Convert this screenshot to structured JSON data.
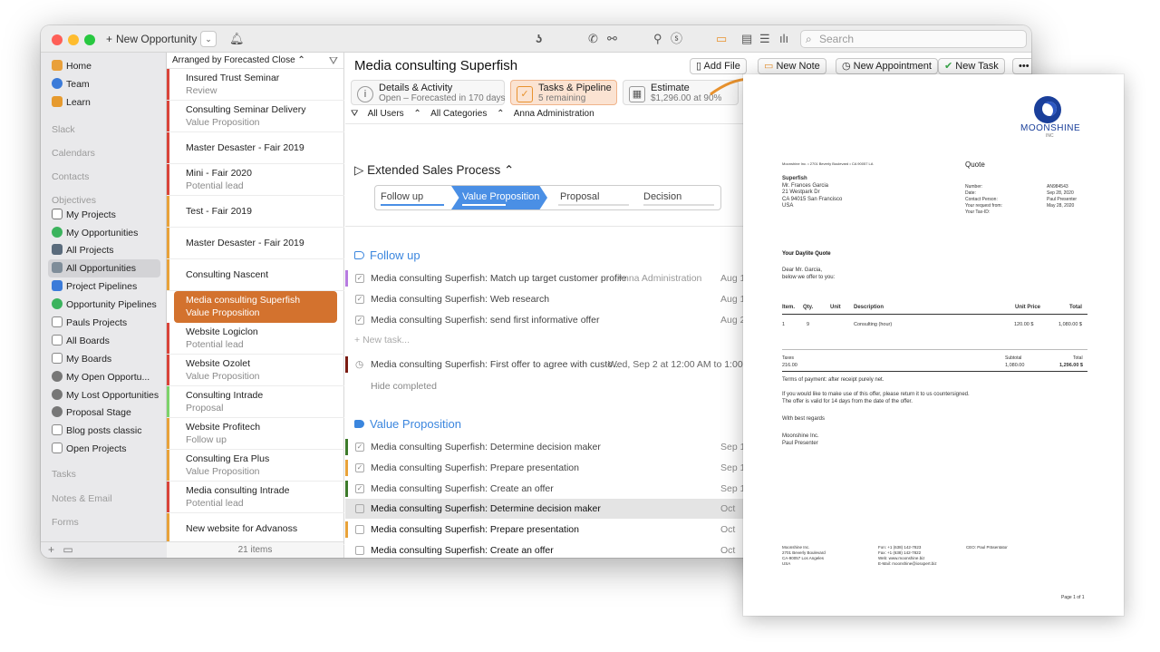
{
  "toolbar": {
    "new_button": "New Opportunity",
    "search_placeholder": "Search"
  },
  "sidebar": {
    "items_top": [
      "Home",
      "Team",
      "Learn"
    ],
    "sections": [
      "Slack",
      "Calendars",
      "Contacts",
      "Objectives",
      "Tasks",
      "Notes & Email",
      "Forms"
    ],
    "objectives": [
      "My Projects",
      "My Opportunities",
      "All Projects",
      "All Opportunities",
      "Project Pipelines",
      "Opportunity Pipelines",
      "Pauls Projects",
      "All Boards",
      "My Boards",
      "My Open Opportu...",
      "My Lost Opportunities",
      "Proposal Stage",
      "Blog posts classic",
      "Open Projects"
    ],
    "active": "All Opportunities",
    "icon_colors": {
      "home": "#e9a03b",
      "team": "#3b7bd9",
      "learn": "#e69a2e",
      "my_opportunities": "#3bb35d",
      "all_projects": "#5a6b7c",
      "all_opportunities": "#7f8d99",
      "project_pipelines": "#3b7bd9",
      "opportunity_pipelines": "#3bb35d"
    }
  },
  "list": {
    "header": "Arranged by Forecasted Close",
    "footer": "21 items",
    "rows": [
      {
        "title": "Insured Trust Seminar",
        "sub": "Review",
        "color": "#d9443a"
      },
      {
        "title": "Consulting Seminar Delivery",
        "sub": "Value Proposition",
        "color": "#d9443a"
      },
      {
        "title": "Master Desaster - Fair 2019",
        "sub": "",
        "color": "#d9443a"
      },
      {
        "title": "Mini - Fair 2020",
        "sub": "Potential lead",
        "color": "#d9443a"
      },
      {
        "title": "Test - Fair 2019",
        "sub": "",
        "color": "#e8a23a"
      },
      {
        "title": "Master Desaster - Fair 2019",
        "sub": "",
        "color": "#e8a23a"
      },
      {
        "title": "Consulting Nascent",
        "sub": "",
        "color": "#e8a23a"
      },
      {
        "title": "Media consulting Superfish",
        "sub": "Value Proposition",
        "color": "#d3722e"
      },
      {
        "title": "Website Logiclon",
        "sub": "Potential lead",
        "color": "#d9443a"
      },
      {
        "title": "Website Ozolet",
        "sub": "Value Proposition",
        "color": "#d9443a"
      },
      {
        "title": "Consulting Intrade",
        "sub": "Proposal",
        "color": "#7cd36a"
      },
      {
        "title": "Website Profitech",
        "sub": "Follow up",
        "color": "#e8a23a"
      },
      {
        "title": "Consulting Era Plus",
        "sub": "Value Proposition",
        "color": "#e8a23a"
      },
      {
        "title": "Media consulting Intrade",
        "sub": "Potential lead",
        "color": "#d9443a"
      },
      {
        "title": "New website for Advanoss",
        "sub": "",
        "color": "#e8a23a"
      }
    ]
  },
  "main": {
    "title": "Media consulting Superfish",
    "buttons": [
      "Add File",
      "New Note",
      "New Appointment",
      "New Task"
    ],
    "tabs": [
      {
        "a": "Details & Activity",
        "b": "Open – Forecasted in 170 days"
      },
      {
        "a": "Tasks & Pipeline",
        "b": "5 remaining"
      },
      {
        "a": "Estimate",
        "b": "$1,296.00 at 90%"
      }
    ],
    "filters": [
      "All Users",
      "All Categories",
      "Anna Administration"
    ],
    "process": "Extended Sales Process",
    "stages": [
      "Follow up",
      "Value Proposition",
      "Proposal",
      "Decision"
    ],
    "section1": "Follow up",
    "section2": "Value Proposition",
    "tasks1": [
      {
        "text": "Media consulting Superfish: Match up target customer profile",
        "who": "Anna Administration",
        "date": "Aug 1",
        "color": "#b77be0"
      },
      {
        "text": "Media consulting Superfish: Web research",
        "who": "",
        "date": "Aug 1",
        "color": ""
      },
      {
        "text": "Media consulting Superfish: send first informative offer",
        "who": "",
        "date": "Aug 2",
        "color": ""
      }
    ],
    "appointment": "Media consulting Superfish: First offer to agree with custo...",
    "appointment_time": "Wed, Sep 2 at 12:00 AM to 1:00 AM",
    "new_task": "New task...",
    "hide_completed": "Hide completed",
    "tasks2": [
      {
        "text": "Media consulting Superfish: Determine decision maker",
        "date": "Sep 1",
        "color": "#3d7a2a"
      },
      {
        "text": "Media consulting Superfish: Prepare presentation",
        "date": "Sep 1",
        "color": "#e8a23a"
      },
      {
        "text": "Media consulting Superfish: Create an offer",
        "date": "Sep 1",
        "color": "#3d7a2a"
      },
      {
        "text": "Media consulting Superfish: Determine decision maker",
        "date": "Oct",
        "color": ""
      },
      {
        "text": "Media consulting Superfish: Prepare presentation",
        "date": "Oct",
        "color": "#e8a23a"
      },
      {
        "text": "Media consulting Superfish: Create an offer",
        "date": "Oct",
        "color": ""
      }
    ]
  },
  "quote": {
    "logo": "MOONSHINE",
    "logo_inc": "INC",
    "sender_line": "Moonshine Inc. • 2701 Beverly Boulevard • CA 90057 LA",
    "title": "Quote",
    "address": [
      "Superfish",
      "Mr. Frances Garcia",
      "21 Westpark Dr",
      "CA 94015 San Francisco",
      "USA"
    ],
    "meta_labels": [
      "Number:",
      "Date:",
      "Contact Person:",
      "Your request from:",
      "Your Tax-ID:"
    ],
    "meta_values": [
      "AN984543",
      "Sep 28, 2020",
      "Paul Presenter",
      "May 28, 2020",
      ""
    ],
    "heading": "Your Daylite Quote",
    "greeting": [
      "Dear Mr. Garcia,",
      "below we offer to you:"
    ],
    "columns": [
      "Item.",
      "Qty.",
      "Unit",
      "Description",
      "Unit Price",
      "Total"
    ],
    "line": [
      "1",
      "9",
      "",
      "Consulting (hour)",
      "120.00 $",
      "1,080.00 $"
    ],
    "taxes_label": "Taxes",
    "taxes_value": "216.00",
    "subtotal_label": "Subtotal",
    "subtotal_value": "1,080.00",
    "total_label": "Total",
    "total_value": "1,296.00 $",
    "terms": "Terms of payment: after receipt purely net.",
    "body": [
      "If you would like to make use of this offer, please return it to us countersigned.",
      "The offer is valid for 14 days from the date of the offer."
    ],
    "regards": "With best regards",
    "signature": [
      "Moonshine Inc.",
      "Paul Presenter"
    ],
    "footer_col1": [
      "Moonshine Inc.",
      "2701 Beverly Boulevard",
      "CA-90057 Los Angeles",
      "USA"
    ],
    "footer_col2": [
      "Fon: +1 (638) 142-7823",
      "Fax: +1 (638) 142-7822",
      "Web: www.moonshine.biz",
      "E-Mail: moonshine@iosxpert.biz"
    ],
    "footer_col3": "CEO: Paul Präsentator",
    "page": "Page 1 of 1"
  }
}
